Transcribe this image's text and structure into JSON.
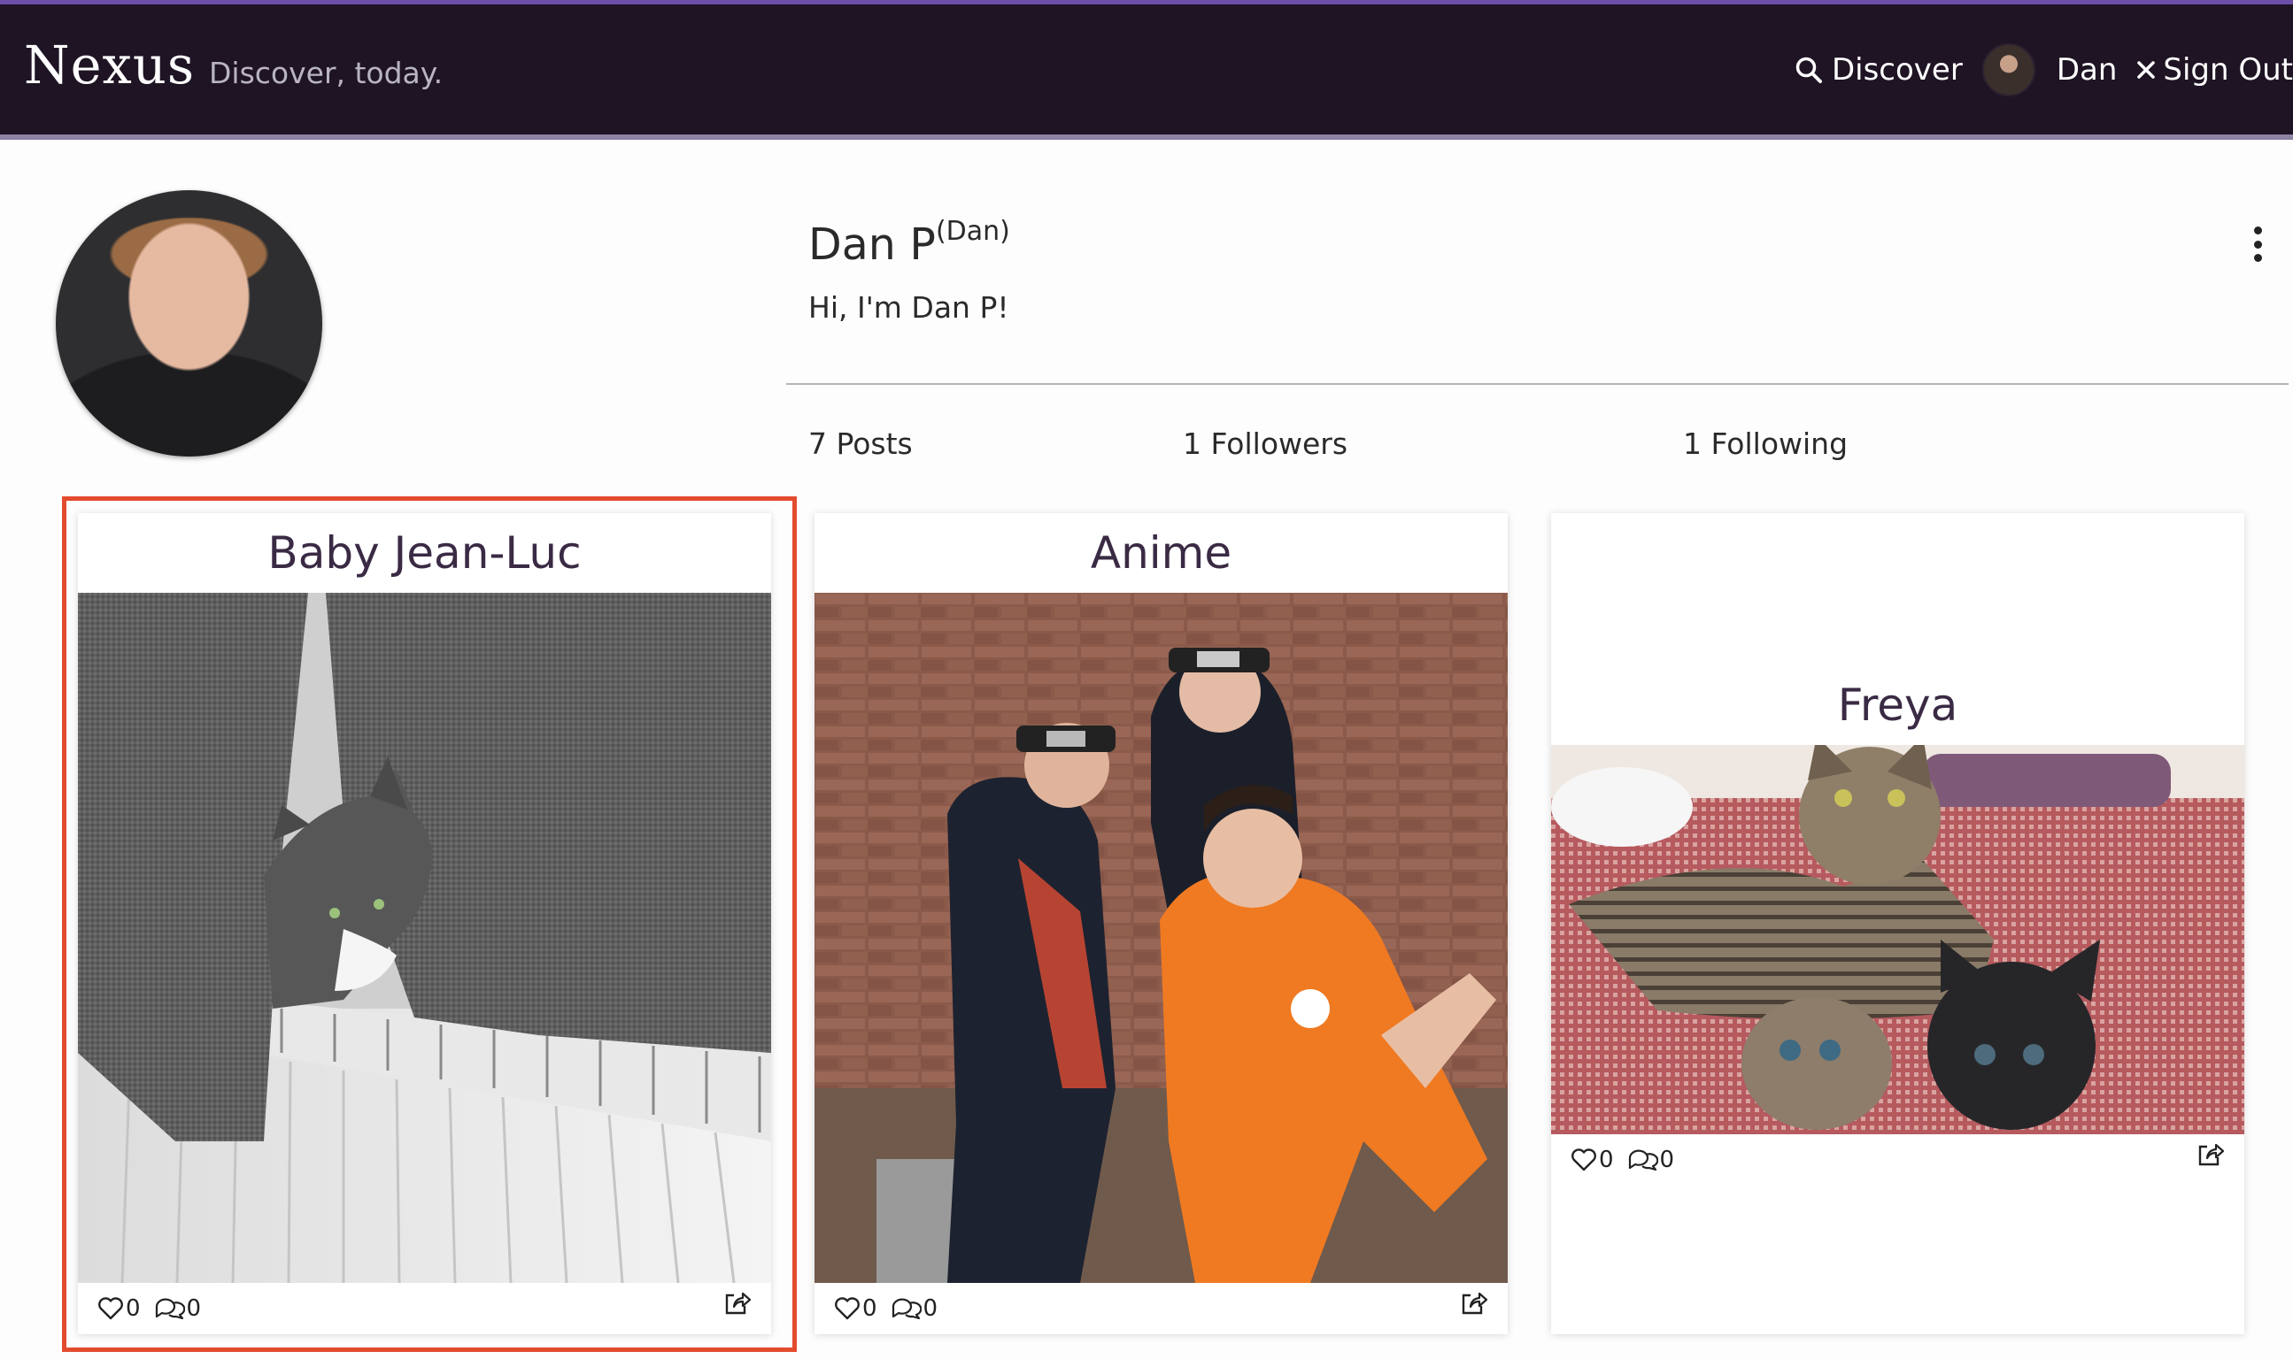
{
  "brand": "Nexus",
  "tagline": "Discover, today.",
  "nav": {
    "discover_label": "Discover",
    "user_label": "Dan",
    "signout_label": "Sign Out"
  },
  "profile": {
    "name": "Dan P",
    "username": "(Dan)",
    "bio": "Hi, I'm Dan P!",
    "posts_label": "7 Posts",
    "followers_label": "1 Followers",
    "following_label": "1 Following"
  },
  "posts": [
    {
      "title": "Baby Jean-Luc",
      "likes": "0",
      "comments": "0",
      "image": "grey-kitten-on-radiator"
    },
    {
      "title": "Anime",
      "likes": "0",
      "comments": "0",
      "image": "anime-cosplay-group"
    },
    {
      "title": "Freya",
      "likes": "0",
      "comments": "0",
      "image": "tabby-cat-with-kittens"
    }
  ],
  "colors": {
    "nav_bg": "#1e1424",
    "nav_accent": "#6b4fa8",
    "highlight": "#e34b2f",
    "card_title": "#3a2a44"
  }
}
